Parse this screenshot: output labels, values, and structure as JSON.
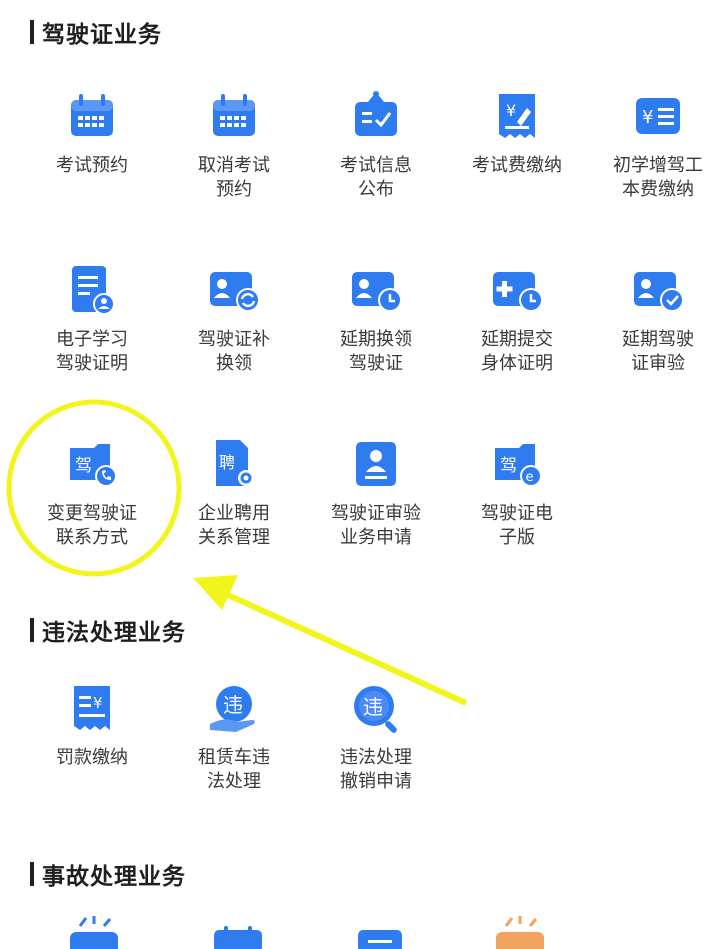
{
  "sections": [
    {
      "title": "驾驶证业务",
      "items": [
        {
          "lines": [
            "考试预约"
          ],
          "icon": "calendar-icon"
        },
        {
          "lines": [
            "取消考试",
            "预约"
          ],
          "icon": "calendar-icon"
        },
        {
          "lines": [
            "考试信息",
            "公布"
          ],
          "icon": "notice-board-icon"
        },
        {
          "lines": [
            "考试费缴纳"
          ],
          "icon": "fee-receipt-icon"
        },
        {
          "lines": [
            "初学增驾工",
            "本费缴纳"
          ],
          "icon": "yuan-card-icon"
        },
        {
          "lines": [
            "电子学习",
            "驾驶证明"
          ],
          "icon": "document-user-icon"
        },
        {
          "lines": [
            "驾驶证补",
            "换领"
          ],
          "icon": "id-card-refresh-icon"
        },
        {
          "lines": [
            "延期换领",
            "驾驶证"
          ],
          "icon": "id-card-clock-icon"
        },
        {
          "lines": [
            "延期提交",
            "身体证明"
          ],
          "icon": "medical-clock-icon"
        },
        {
          "lines": [
            "延期驾驶",
            "证审验"
          ],
          "icon": "id-card-check-icon"
        },
        {
          "lines": [
            "变更驾驶证",
            "联系方式"
          ],
          "icon": "license-phone-icon",
          "glyph": "驾"
        },
        {
          "lines": [
            "企业聘用",
            "关系管理"
          ],
          "icon": "hire-document-gear-icon",
          "glyph": "聘"
        },
        {
          "lines": [
            "驾驶证审验",
            "业务申请"
          ],
          "icon": "person-badge-icon"
        },
        {
          "lines": [
            "驾驶证电",
            "子版"
          ],
          "icon": "license-electronic-icon",
          "glyph": "驾"
        }
      ]
    },
    {
      "title": "违法处理业务",
      "items": [
        {
          "lines": [
            "罚款缴纳"
          ],
          "icon": "fine-receipt-icon"
        },
        {
          "lines": [
            "租赁车违",
            "法处理"
          ],
          "icon": "hand-violation-icon",
          "glyph": "违"
        },
        {
          "lines": [
            "违法处理",
            "撤销申请"
          ],
          "icon": "violation-search-icon",
          "glyph": "违"
        }
      ]
    },
    {
      "title": "事故处理业务",
      "items": []
    }
  ],
  "colors": {
    "icon_blue": "#2f7bf0",
    "icon_light": "#7fb2ff",
    "highlight_yellow": "#f2f51c"
  }
}
